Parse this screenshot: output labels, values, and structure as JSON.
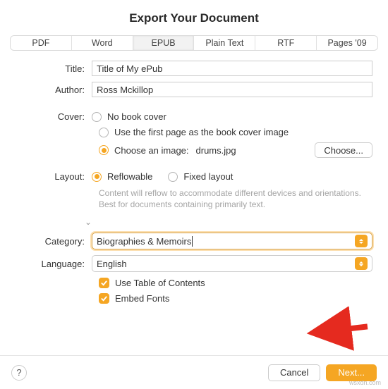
{
  "dialog": {
    "title": "Export Your Document"
  },
  "tabs": [
    "PDF",
    "Word",
    "EPUB",
    "Plain Text",
    "RTF",
    "Pages '09"
  ],
  "fields": {
    "title_label": "Title:",
    "title_value": "Title of My ePub",
    "author_label": "Author:",
    "author_value": "Ross Mckillop"
  },
  "cover": {
    "label": "Cover:",
    "none": "No book cover",
    "firstpage": "Use the first page as the book cover image",
    "choose": "Choose an image:",
    "filename": "drums.jpg",
    "choose_btn": "Choose..."
  },
  "layout": {
    "label": "Layout:",
    "reflow": "Reflowable",
    "fixed": "Fixed layout",
    "help": "Content will reflow to accommodate different devices and orientations. Best for documents containing primarily text."
  },
  "category": {
    "label": "Category:",
    "value": "Biographies & Memoirs"
  },
  "language": {
    "label": "Language:",
    "value": "English"
  },
  "options": {
    "toc": "Use Table of Contents",
    "fonts": "Embed Fonts"
  },
  "footer": {
    "help": "?",
    "cancel": "Cancel",
    "next": "Next..."
  },
  "watermark": "wsxdn.com"
}
